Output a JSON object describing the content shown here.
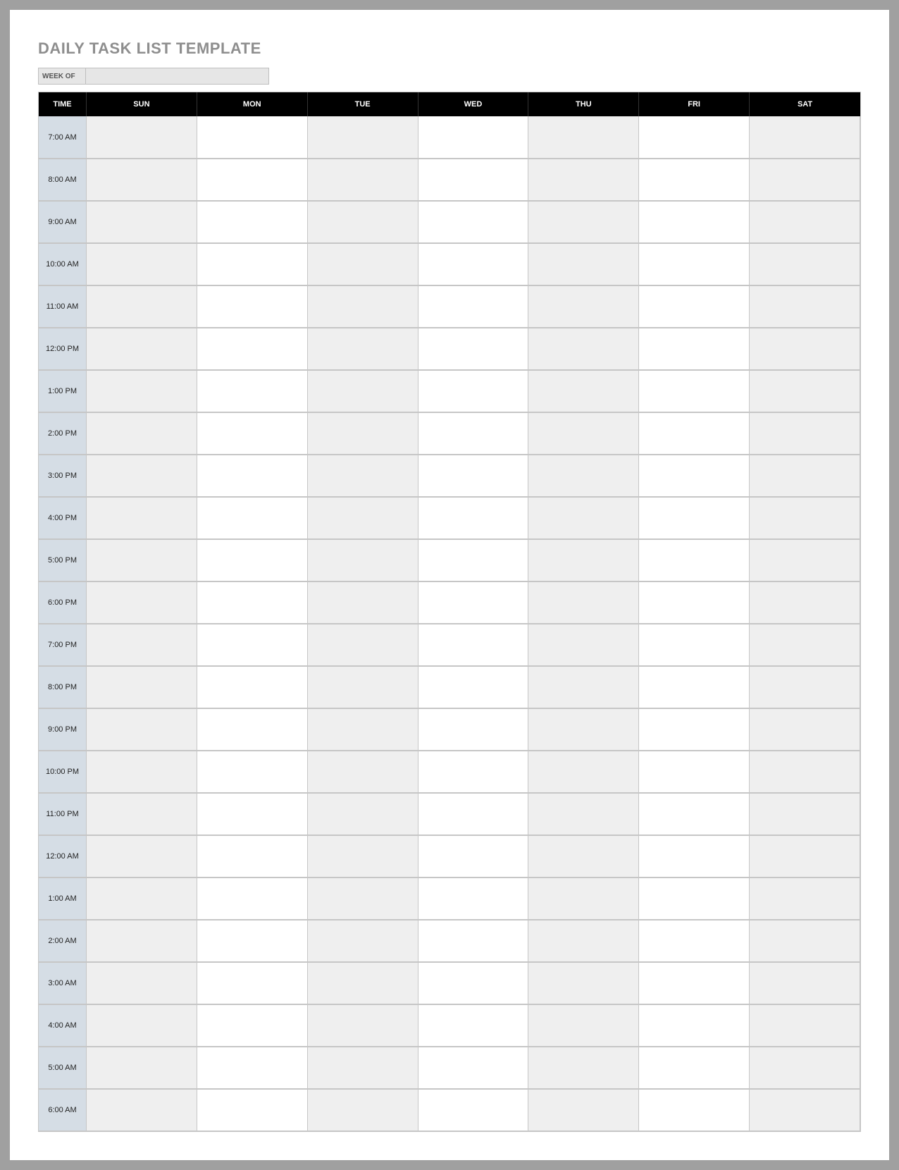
{
  "title": "DAILY TASK LIST TEMPLATE",
  "week_of": {
    "label": "WEEK OF",
    "value": ""
  },
  "headers": {
    "time": "TIME",
    "days": [
      "SUN",
      "MON",
      "TUE",
      "WED",
      "THU",
      "FRI",
      "SAT"
    ]
  },
  "times": [
    "7:00 AM",
    "8:00 AM",
    "9:00 AM",
    "10:00 AM",
    "11:00 AM",
    "12:00 PM",
    "1:00 PM",
    "2:00 PM",
    "3:00 PM",
    "4:00 PM",
    "5:00 PM",
    "6:00 PM",
    "7:00 PM",
    "8:00 PM",
    "9:00 PM",
    "10:00 PM",
    "11:00 PM",
    "12:00 AM",
    "1:00 AM",
    "2:00 AM",
    "3:00 AM",
    "4:00 AM",
    "5:00 AM",
    "6:00 AM"
  ]
}
